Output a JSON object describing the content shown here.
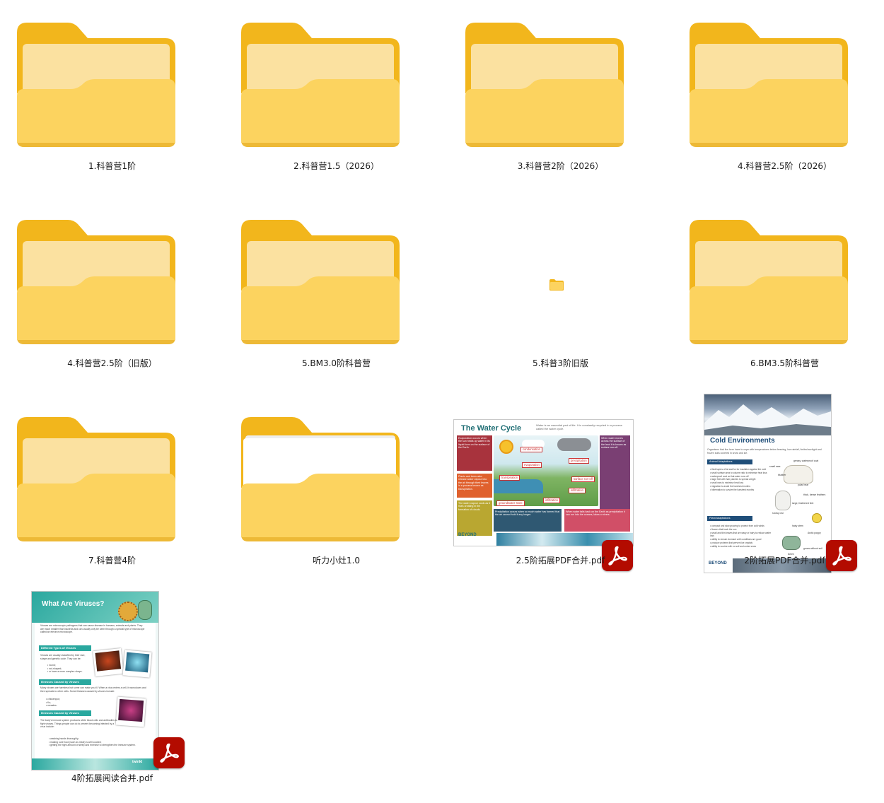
{
  "items": [
    {
      "name": "1.科普营1阶",
      "type": "folder"
    },
    {
      "name": "2.科普营1.5（2026）",
      "type": "folder"
    },
    {
      "name": "3.科普营2阶（2026）",
      "type": "folder"
    },
    {
      "name": "4.科普营2.5阶（2026）",
      "type": "folder"
    },
    {
      "name": "4.科普营2.5阶（旧版）",
      "type": "folder"
    },
    {
      "name": "5.BM3.0阶科普营",
      "type": "folder"
    },
    {
      "name": "5.科普3阶旧版",
      "type": "folder-loading"
    },
    {
      "name": "6.BM3.5阶科普营",
      "type": "folder"
    },
    {
      "name": "7.科普营4阶",
      "type": "folder"
    },
    {
      "name": "听力小灶1.0",
      "type": "folder-with-papers"
    },
    {
      "name": "2.5阶拓展PDF合并.pdf",
      "type": "pdf"
    },
    {
      "name": "2阶拓展PDF合并.pdf",
      "type": "pdf"
    },
    {
      "name": "4阶拓展阅读合并.pdf",
      "type": "pdf"
    }
  ],
  "thumbnails": {
    "water_cycle": {
      "title": "The Water Cycle",
      "intro": "Water is an essential part of life. It is constantly recycled in a process called the water cycle.",
      "tags": [
        "condensation",
        "evaporation",
        "precipitation",
        "transpiration",
        "surface run-off",
        "infiltration",
        "groundwater store",
        "infiltration"
      ],
      "boxes": [
        "Evaporation occurs when the sun heats up water in its liquid form on the surface of the Earth.",
        "Plants and trees also release water vapour into the air through their leaves in a process known as transpiration.",
        "The water vapour cools as it rises creating in the formation of clouds.",
        "When water moves across the surface of the land it is known as surface run-off.",
        "Precipitation occurs when so much water has formed that the air cannot hold it any longer.",
        "When water falls back on the Earth as precipitation it can run into the oceans, lakes or rivers."
      ],
      "logo": "BEYOND"
    },
    "cold_env": {
      "title": "Cold Environments",
      "intro": "Organisms that live here have to cope with temperatures below freezing, low rainfall, limited sunlight and frozen soils covered in snow and ice.",
      "sections": [
        "Animal Adaptations",
        "Plant Adaptations"
      ],
      "animal_points": [
        "thick layers of fat and fur for insulation against the cold",
        "small surface area to volume ratio to minimise heat loss",
        "waterproof coat so that water runs off",
        "large feet with hair patches to spread weight",
        "small ears to minimise heat loss",
        "migration to avoid the harshest months",
        "hibernation to survive the harshest months"
      ],
      "plant_points": [
        "compact and slow growing to protect from cold winds",
        "flowers that track the sun",
        "small and thin leaves that are waxy or hairy to reduce water loss",
        "ability to remain dormant until conditions are good",
        "produce proteins that prevent ice crystals",
        "ability to survive with no soil and under snow"
      ],
      "labels": [
        "greasy, waterproof coat",
        "small ears",
        "blubber",
        "polar bear",
        "thick, dense feathers",
        "large, feathered feet",
        "snowy owl",
        "Arctic poppy",
        "hairy stem",
        "lichen",
        "grows without soil"
      ],
      "logo": "BEYOND"
    },
    "viruses": {
      "title": "What Are Viruses?",
      "intro": "Viruses are microscopic pathogens that can cause disease in humans, animals and plants. They are much smaller than bacteria and can usually only be seen through a special type of microscope called an electron microscope.",
      "sections": [
        "Different Types of Viruses",
        "Illnesses Caused by Viruses",
        "Illnesses Caused by Viruses"
      ],
      "types_intro": "Viruses are usually classified by their size, shape and genetic code. They can be:",
      "types": [
        "round;",
        "rod-shaped;",
        "or have a more complex shape."
      ],
      "illness_intro": "Many viruses are harmless but some can make you ill. When a virus enters a cell, it reproduces and then spreads to other cells. Some illnesses caused by viruses include:",
      "illnesses": [
        "chickenpox;",
        "flu;",
        "measles."
      ],
      "immune_text": "The body's immune system produces white blood cells and antibodies to fight viruses. Things people can do to prevent becoming infected by a virus include:",
      "prevention": [
        "washing hands thoroughly;",
        "making sure food (such as meat) is well cooked;",
        "getting the right amount of sleep and exercise to strengthen the immune system."
      ],
      "logo": "twinkl"
    }
  },
  "colors": {
    "folder_back": "#f2b61c",
    "folder_front": "#fcd35f",
    "paper": "#fbe1a0",
    "pdf_badge": "#b30b00"
  }
}
